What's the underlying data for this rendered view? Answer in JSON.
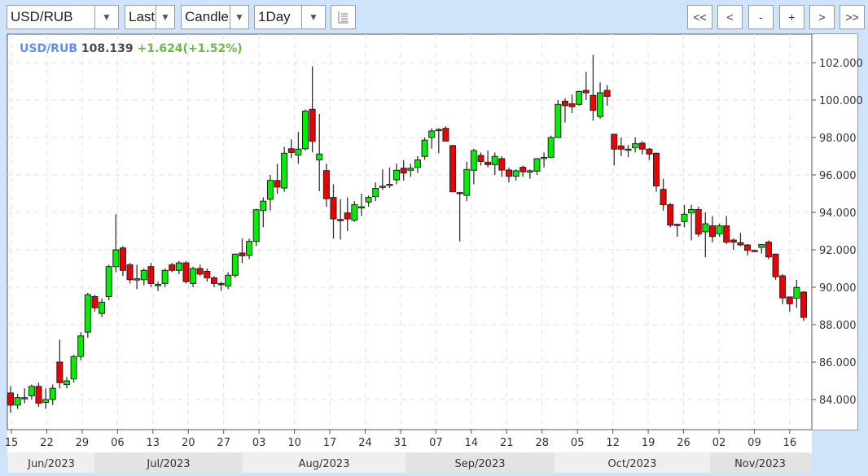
{
  "toolbar": {
    "symbol": "USD/RUB",
    "price_type": "Last",
    "chart_type": "Candle",
    "interval": "1Day",
    "indicators_icon": "table-icon",
    "nav_buttons": [
      "<<",
      "<",
      "-",
      "+",
      ">",
      ">>"
    ]
  },
  "legend": {
    "symbol": "USD/RUB",
    "last": "108.139",
    "change": "+1.624(+1.52%)"
  },
  "colors": {
    "up": "#00ee00",
    "down": "#ee0000",
    "symbol": "#5b8ff0",
    "change": "#66bb44"
  },
  "chart_data": {
    "type": "candlestick",
    "title": "USD/RUB",
    "ylim": [
      82.5,
      103.5
    ],
    "y_ticks": [
      "84.000",
      "86.000",
      "88.000",
      "90.000",
      "92.000",
      "94.000",
      "96.000",
      "98.000",
      "100.000",
      "102.000"
    ],
    "y_tick_values": [
      84,
      86,
      88,
      90,
      92,
      94,
      96,
      98,
      100,
      102
    ],
    "x_ticks": [
      "15",
      "22",
      "29",
      "06",
      "13",
      "20",
      "27",
      "03",
      "10",
      "17",
      "24",
      "31",
      "07",
      "14",
      "21",
      "28",
      "05",
      "12",
      "19",
      "26",
      "02",
      "09",
      "16"
    ],
    "months": [
      "Jun/2023",
      "Jul/2023",
      "Aug/2023",
      "Sep/2023",
      "Oct/2023",
      "Nov/2023"
    ],
    "grid": true,
    "ohlc": [
      [
        84.35,
        84.7,
        83.3,
        83.7
      ],
      [
        83.7,
        84.3,
        83.5,
        84.1
      ],
      [
        84.05,
        84.6,
        83.8,
        84.1
      ],
      [
        84.2,
        84.8,
        84.0,
        84.7
      ],
      [
        84.7,
        84.9,
        83.6,
        83.8
      ],
      [
        83.85,
        84.6,
        83.5,
        84.0
      ],
      [
        84.0,
        84.8,
        83.7,
        84.6
      ],
      [
        86.0,
        87.2,
        84.6,
        84.9
      ],
      [
        84.8,
        85.2,
        84.6,
        85.0
      ],
      [
        85.1,
        86.4,
        84.9,
        86.3
      ],
      [
        86.3,
        87.6,
        86.1,
        87.4
      ],
      [
        87.6,
        89.7,
        87.3,
        89.6
      ],
      [
        89.5,
        89.6,
        88.7,
        88.9
      ],
      [
        88.6,
        89.4,
        88.4,
        89.2
      ],
      [
        89.5,
        91.2,
        89.3,
        91.1
      ],
      [
        91.1,
        93.9,
        90.8,
        92.0
      ],
      [
        92.1,
        92.2,
        90.6,
        90.9
      ],
      [
        91.2,
        91.3,
        90.2,
        90.4
      ],
      [
        90.45,
        91.2,
        89.9,
        90.45
      ],
      [
        90.4,
        91.0,
        90.1,
        90.9
      ],
      [
        91.1,
        91.3,
        90.0,
        90.2
      ],
      [
        90.15,
        90.3,
        89.8,
        90.15
      ],
      [
        90.2,
        91.0,
        90.0,
        90.9
      ],
      [
        91.2,
        91.3,
        90.8,
        90.9
      ],
      [
        90.9,
        91.4,
        90.7,
        91.3
      ],
      [
        91.3,
        91.4,
        90.2,
        90.3
      ],
      [
        90.2,
        91.1,
        90.0,
        91.0
      ],
      [
        91.0,
        91.2,
        90.6,
        90.7
      ],
      [
        90.85,
        91.0,
        90.3,
        90.5
      ],
      [
        90.5,
        90.6,
        90.0,
        90.2
      ],
      [
        90.2,
        90.3,
        89.8,
        90.15
      ],
      [
        90.06,
        90.8,
        89.9,
        90.64
      ],
      [
        90.64,
        91.8,
        90.5,
        91.77
      ],
      [
        91.83,
        92.6,
        91.3,
        91.68
      ],
      [
        91.7,
        92.6,
        91.5,
        92.45
      ],
      [
        92.45,
        94.2,
        92.2,
        94.14
      ],
      [
        94.1,
        94.8,
        93.2,
        94.6
      ],
      [
        94.7,
        96.0,
        94.1,
        95.71
      ],
      [
        95.7,
        96.6,
        95.0,
        95.35
      ],
      [
        95.3,
        97.5,
        95.1,
        97.16
      ],
      [
        97.4,
        97.9,
        96.9,
        97.2
      ],
      [
        97.06,
        98.3,
        96.6,
        97.38
      ],
      [
        97.4,
        99.5,
        97.3,
        99.41
      ],
      [
        99.51,
        101.8,
        97.2,
        97.8
      ],
      [
        96.8,
        99.26,
        95.13,
        97.12
      ],
      [
        96.23,
        96.6,
        94.3,
        94.73
      ],
      [
        94.8,
        95.5,
        92.6,
        93.65
      ],
      [
        93.62,
        94.7,
        92.55,
        93.6
      ],
      [
        93.97,
        94.8,
        93.0,
        93.65
      ],
      [
        93.58,
        94.6,
        93.5,
        94.41
      ],
      [
        94.26,
        95.0,
        93.8,
        94.3
      ],
      [
        94.55,
        94.9,
        94.3,
        94.8
      ],
      [
        94.84,
        95.6,
        94.6,
        95.28
      ],
      [
        95.35,
        96.3,
        95.2,
        95.4
      ],
      [
        95.46,
        96.4,
        95.3,
        95.5
      ],
      [
        95.74,
        96.6,
        95.5,
        96.25
      ],
      [
        96.36,
        96.8,
        95.7,
        96.1
      ],
      [
        96.25,
        96.6,
        95.9,
        96.36
      ],
      [
        96.4,
        97.0,
        96.1,
        96.8
      ],
      [
        96.99,
        98.0,
        96.8,
        97.86
      ],
      [
        98.0,
        98.5,
        97.4,
        98.35
      ],
      [
        98.43,
        98.5,
        97.16,
        98.43
      ],
      [
        98.49,
        98.6,
        97.9,
        97.81
      ],
      [
        97.57,
        97.6,
        95.1,
        95.1
      ],
      [
        95.06,
        95.1,
        92.45,
        95.0
      ],
      [
        94.91,
        96.7,
        94.6,
        96.29
      ],
      [
        96.25,
        97.4,
        95.5,
        97.3
      ],
      [
        97.04,
        97.2,
        96.5,
        96.72
      ],
      [
        96.68,
        97.3,
        96.4,
        96.55
      ],
      [
        96.55,
        97.2,
        96.0,
        96.99
      ],
      [
        96.87,
        97.0,
        95.9,
        96.26
      ],
      [
        96.26,
        96.4,
        95.6,
        95.93
      ],
      [
        95.93,
        96.3,
        95.7,
        96.22
      ],
      [
        96.41,
        96.5,
        95.9,
        96.17
      ],
      [
        96.2,
        96.3,
        95.8,
        96.22
      ],
      [
        96.2,
        96.9,
        96.0,
        96.87
      ],
      [
        96.94,
        97.2,
        96.4,
        96.94
      ],
      [
        96.94,
        98.1,
        96.9,
        98.0
      ],
      [
        98.0,
        100.0,
        98.0,
        99.77
      ],
      [
        99.94,
        100.1,
        98.8,
        99.7
      ],
      [
        99.8,
        100.3,
        99.3,
        99.65
      ],
      [
        99.77,
        100.5,
        99.7,
        100.46
      ],
      [
        100.52,
        101.51,
        100.0,
        100.39
      ],
      [
        100.25,
        102.42,
        98.9,
        99.45
      ],
      [
        99.12,
        100.94,
        99.0,
        100.39
      ],
      [
        100.52,
        100.8,
        99.7,
        100.2
      ],
      [
        98.17,
        98.2,
        96.5,
        97.38
      ],
      [
        97.55,
        98.0,
        97.0,
        97.38
      ],
      [
        97.38,
        97.6,
        96.95,
        97.38
      ],
      [
        97.45,
        98.0,
        97.2,
        97.67
      ],
      [
        97.7,
        97.8,
        97.1,
        97.38
      ],
      [
        97.38,
        97.45,
        96.8,
        97.12
      ],
      [
        97.16,
        97.2,
        95.1,
        95.41
      ],
      [
        95.23,
        95.8,
        94.1,
        94.41
      ],
      [
        94.41,
        94.5,
        93.2,
        93.32
      ],
      [
        93.36,
        93.4,
        92.7,
        93.32
      ],
      [
        93.51,
        94.4,
        93.2,
        93.9
      ],
      [
        93.97,
        94.4,
        92.5,
        94.15
      ],
      [
        94.15,
        94.3,
        92.7,
        92.84
      ],
      [
        92.96,
        94.0,
        91.6,
        93.39
      ],
      [
        93.28,
        93.8,
        92.4,
        92.71
      ],
      [
        92.85,
        93.4,
        92.7,
        93.28
      ],
      [
        93.28,
        93.8,
        92.3,
        92.41
      ],
      [
        92.52,
        92.6,
        92.0,
        92.41
      ],
      [
        92.38,
        92.9,
        92.2,
        92.26
      ],
      [
        92.26,
        92.3,
        91.7,
        91.97
      ],
      [
        91.97,
        92.0,
        91.9,
        91.95
      ],
      [
        92.13,
        92.3,
        91.8,
        92.28
      ],
      [
        92.41,
        92.5,
        91.5,
        91.62
      ],
      [
        91.77,
        91.8,
        90.4,
        90.56
      ],
      [
        90.61,
        90.7,
        89.1,
        89.43
      ],
      [
        89.48,
        89.5,
        88.7,
        89.12
      ],
      [
        89.41,
        90.4,
        88.9,
        89.99
      ],
      [
        89.74,
        89.8,
        88.2,
        88.39
      ]
    ]
  }
}
